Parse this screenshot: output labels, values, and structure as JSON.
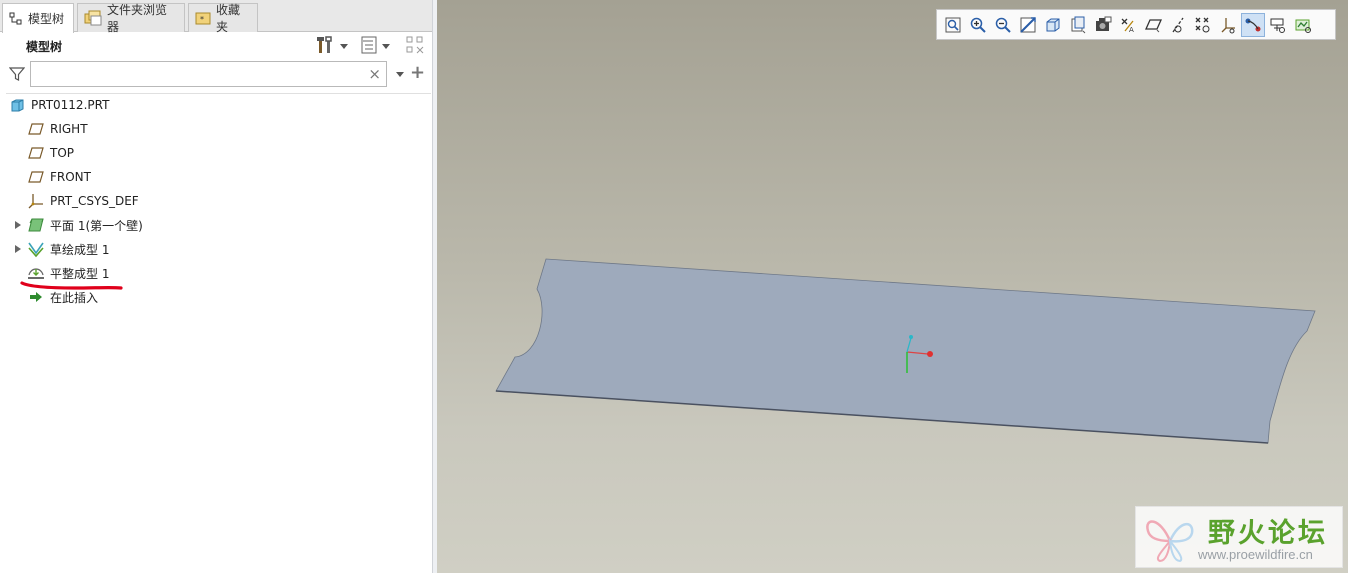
{
  "tabs": [
    {
      "label": "模型树",
      "icon": "model-tree-icon",
      "active": true
    },
    {
      "label": "文件夹浏览器",
      "icon": "folder-browser-icon",
      "active": false
    },
    {
      "label": "收藏夹",
      "icon": "favorites-icon",
      "active": false
    }
  ],
  "panel": {
    "title": "模型树",
    "tools": [
      "settings-tools-icon",
      "tree-view-icon",
      "tree-filter-icon"
    ]
  },
  "search": {
    "value": "",
    "placeholder": "",
    "clear_glyph": "×",
    "add_glyph": "+"
  },
  "tree": {
    "items": [
      {
        "label": "PRT0112.PRT",
        "icon": "part-icon"
      },
      {
        "label": "RIGHT",
        "icon": "datum-plane-icon"
      },
      {
        "label": "TOP",
        "icon": "datum-plane-icon"
      },
      {
        "label": "FRONT",
        "icon": "datum-plane-icon"
      },
      {
        "label": "PRT_CSYS_DEF",
        "icon": "coordinate-system-icon"
      },
      {
        "label": "平面 1(第一个壁)",
        "icon": "planar-wall-icon"
      },
      {
        "label": "草绘成型 1",
        "icon": "sketched-form-icon"
      },
      {
        "label": "平整成型 1",
        "icon": "flatten-form-icon"
      },
      {
        "label": "在此插入",
        "icon": "insert-here-arrow-icon"
      }
    ]
  },
  "view_toolbar": {
    "icons": [
      "refit-icon",
      "zoom-in-icon",
      "zoom-out-icon",
      "repaint-icon",
      "display-style-icon",
      "saved-orientations-icon",
      "view-manager-icon",
      "annotation-display-icon",
      "plane-display-icon",
      "axis-display-icon",
      "point-display-icon",
      "csys-display-icon",
      "spin-center-icon",
      "annotation-orientation-icon",
      "simulation-display-icon"
    ],
    "active": "spin-center-icon"
  },
  "watermark": {
    "name": "野火论坛",
    "url": "www.proewildfire.cn"
  },
  "colors": {
    "sheet": "#9eaabc",
    "viewport_top": "#a4a193",
    "viewport_bottom": "#d0cfc4",
    "annotation": "#e0001b",
    "form_green": "#5aa22d"
  }
}
